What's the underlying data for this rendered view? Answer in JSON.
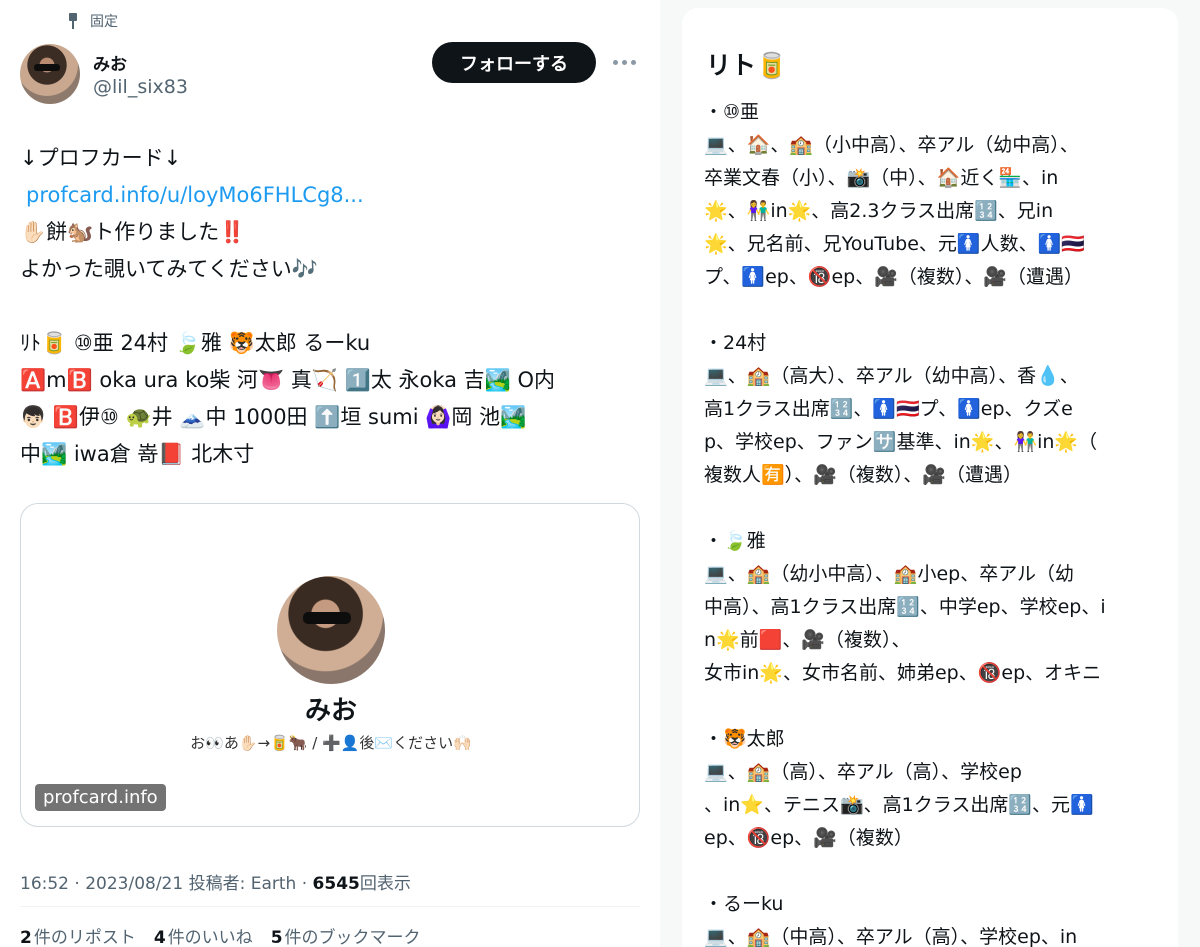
{
  "tweet": {
    "pinned_label": "固定",
    "author_name": "みお",
    "author_handle": "@lil_six83",
    "follow_label": "フォローする",
    "lines": [
      "↓プロフカード↓",
      "✋🏻餅🐿️ト作りました‼️",
      "よかった覗いてみてください🎶"
    ],
    "link": "profcard.info/u/loyMo6FHLCg8...",
    "tag_lines": [
      "ﾘﾄ🥫 ⑩亜 24村 🍃雅 🐯太郎 るーku",
      "🅰️m🅱️ oka ura ko柴 河👅 真🏹 1️⃣太 永oka 吉🏞️ O内",
      "👦🏻 🅱️伊⑩ 🐢井 🗻中 1000田 ⬆️垣 sumi 🙆🏻‍♀️岡 池🏞️",
      "中🏞️ iwa倉 嵜📕 北木寸"
    ]
  },
  "card": {
    "name": "みお",
    "bio": "お👀あ✋🏻→🥫🐂 / ➕👤後✉️ください🙌🏻",
    "domain": "profcard.info"
  },
  "meta": {
    "time": "16:52 · 2023/08/21 投稿者: Earth · ",
    "views_num": "6545",
    "views_label": "回表示"
  },
  "stats": {
    "reposts_num": "2",
    "reposts_label": "件のリポスト",
    "likes_num": "4",
    "likes_label": "件のいいね",
    "bookmarks_num": "5",
    "bookmarks_label": "件のブックマーク"
  },
  "panel": {
    "title": "リト🥫",
    "sections": [
      {
        "heading": "・⑩亜",
        "lines": [
          "💻、🏠、🏫（小中高）、卒アル（幼中高）、",
          "卒業文春（小）、📸（中）、🏠近く🏪、in",
          "🌟、👫in🌟、高2.3クラス出席🔢、兄in",
          "🌟、兄名前、兄YouTube、元🚺人数、🚺🇹🇭",
          "プ、🚺ep、🔞ep、🎥（複数）、🎥（遭遇）"
        ]
      },
      {
        "heading": "・24村",
        "lines": [
          "💻、🏫（高大）、卒アル（幼中高）、香💧、",
          "高1クラス出席🔢、🚺🇹🇭プ、🚺ep、クズe",
          "p、学校ep、ファン🈂️基準、in🌟、👫in🌟（",
          "複数人🈶）、🎥（複数）、🎥（遭遇）"
        ]
      },
      {
        "heading": "・🍃雅",
        "lines": [
          "💻、🏫（幼小中高）、🏫小ep、卒アル（幼",
          "中高）、高1クラス出席🔢、中学ep、学校ep、i",
          "n🌟前🟥、🎥（複数）、",
          "女市in🌟、女市名前、姉弟ep、🔞ep、オキニ"
        ]
      },
      {
        "heading": "・🐯太郎",
        "lines": [
          "💻、🏫（高）、卒アル（高）、学校ep",
          "、in⭐、テニス📸、高1クラス出席🔢、元🚺",
          "ep、🔞ep、🎥（複数）"
        ]
      },
      {
        "heading": "・るーku",
        "lines": [
          "💻、🏫（中高）、卒アル（高）、学校ep、in"
        ]
      }
    ]
  },
  "colors": {
    "link": "#1d9bf0",
    "follow_button": "#0f1419",
    "secondary_text": "#536471"
  }
}
